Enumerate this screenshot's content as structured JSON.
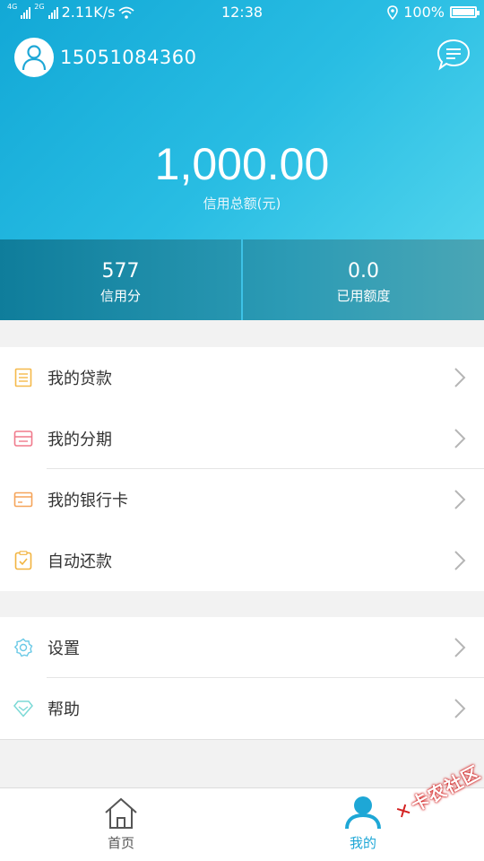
{
  "status_bar": {
    "net_4g": "4G",
    "net_2g": "2G",
    "speed": "2.11K/s",
    "time": "12:38",
    "battery": "100%"
  },
  "user": {
    "phone": "15051084360"
  },
  "credit": {
    "amount": "1,000.00",
    "label": "信用总额(元)"
  },
  "stats": [
    {
      "value": "577",
      "label": "信用分"
    },
    {
      "value": "0.0",
      "label": "已用额度"
    }
  ],
  "menu_group_1": [
    {
      "label": "我的贷款",
      "icon": "loan-list-icon",
      "color": "#f5b94a"
    },
    {
      "label": "我的分期",
      "icon": "installment-icon",
      "color": "#f07a8c"
    },
    {
      "label": "我的银行卡",
      "icon": "bank-card-icon",
      "color": "#f5a45a"
    },
    {
      "label": "自动还款",
      "icon": "auto-repay-icon",
      "color": "#f2b440"
    }
  ],
  "menu_group_2": [
    {
      "label": "设置",
      "icon": "gear-icon",
      "color": "#6ac9e6"
    },
    {
      "label": "帮助",
      "icon": "help-diamond-icon",
      "color": "#7bd9d6"
    }
  ],
  "tabbar": {
    "home_label": "首页",
    "mine_label": "我的",
    "active_color": "#1ea7d6",
    "inactive_color": "#555555"
  },
  "watermark": {
    "text": "卡农社区"
  },
  "colors": {
    "header_start": "#12a8d6",
    "header_end": "#4fd3ec",
    "stats_bg": "#0f7d9b"
  }
}
